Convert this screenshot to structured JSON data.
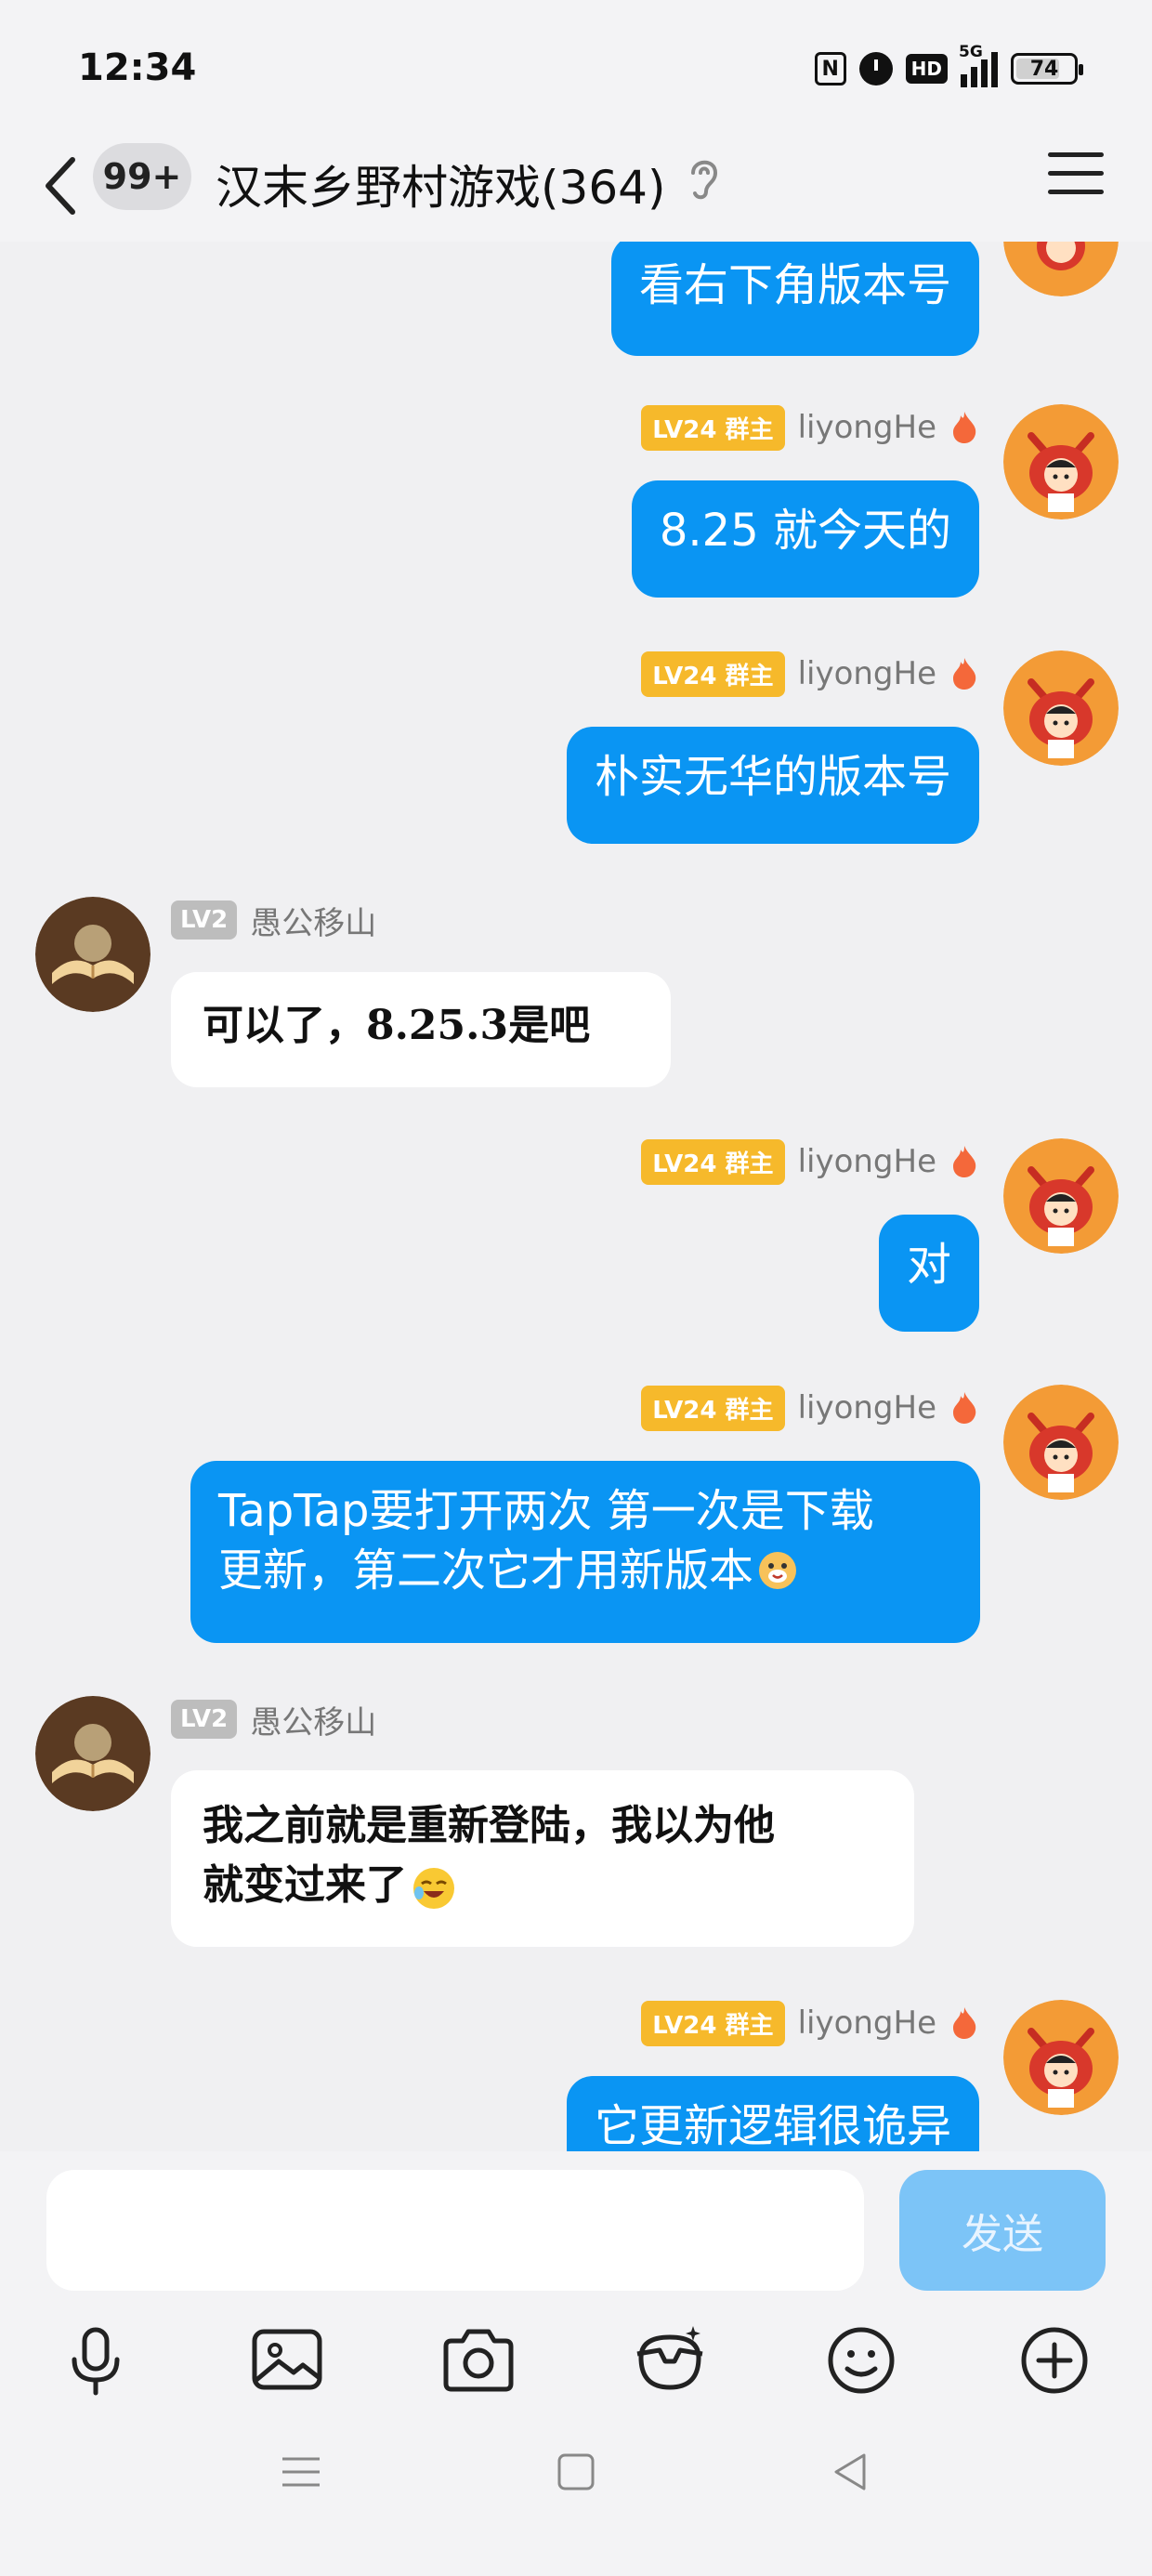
{
  "status_bar": {
    "time": "12:34",
    "icons": [
      "nfc-icon",
      "alarm-icon",
      "hd-icon",
      "5g-signal-icon",
      "battery-icon"
    ],
    "nfc_label": "N",
    "hd_label": "HD",
    "network": "5G",
    "battery": "74"
  },
  "header": {
    "back_icon": "chevron-left-icon",
    "unread_badge": "99+",
    "title": "汉末乡野村游戏(364)",
    "ear_icon": "ear-icon",
    "menu_icon": "hamburger-menu-icon"
  },
  "messages": [
    {
      "side": "right",
      "text": "看右下角版本号"
    },
    {
      "side": "right",
      "level": "LV24",
      "role": "群主",
      "name": "liyongHe",
      "text": "8.25 就今天的"
    },
    {
      "side": "right",
      "level": "LV24",
      "role": "群主",
      "name": "liyongHe",
      "text": "朴实无华的版本号"
    },
    {
      "side": "left",
      "level": "LV2",
      "name": "愚公移山",
      "text": "可以了，8.25.3是吧"
    },
    {
      "side": "right",
      "level": "LV24",
      "role": "群主",
      "name": "liyongHe",
      "text": "对"
    },
    {
      "side": "right",
      "level": "LV24",
      "role": "群主",
      "name": "liyongHe",
      "text_line1": "TapTap要打开两次 第一次是下载",
      "text_line2": "更新，第二次它才用新版本",
      "emoji": "grinning-dog-emoji"
    },
    {
      "side": "left",
      "level": "LV2",
      "name": "愚公移山",
      "text_line1": "我之前就是重新登陆，我以为他",
      "text_line2": "就变过来了",
      "emoji": "laughing-tears-emoji"
    },
    {
      "side": "right",
      "level": "LV24",
      "role": "群主",
      "name": "liyongHe",
      "text": "它更新逻辑很诡异"
    }
  ],
  "composer": {
    "input_value": "",
    "send_label": "发送",
    "tools": [
      "microphone-icon",
      "image-icon",
      "camera-icon",
      "sticker-icon",
      "emoji-icon",
      "plus-icon"
    ]
  },
  "nav_bar": [
    "menu-nav-icon",
    "home-nav-icon",
    "back-nav-icon"
  ],
  "colors": {
    "outgoing_bubble": "#0a95f3",
    "incoming_bubble": "#ffffff",
    "owner_badge": "#f6b92b",
    "background": "#f0f0f2",
    "send_button": "#7cc4f7"
  }
}
